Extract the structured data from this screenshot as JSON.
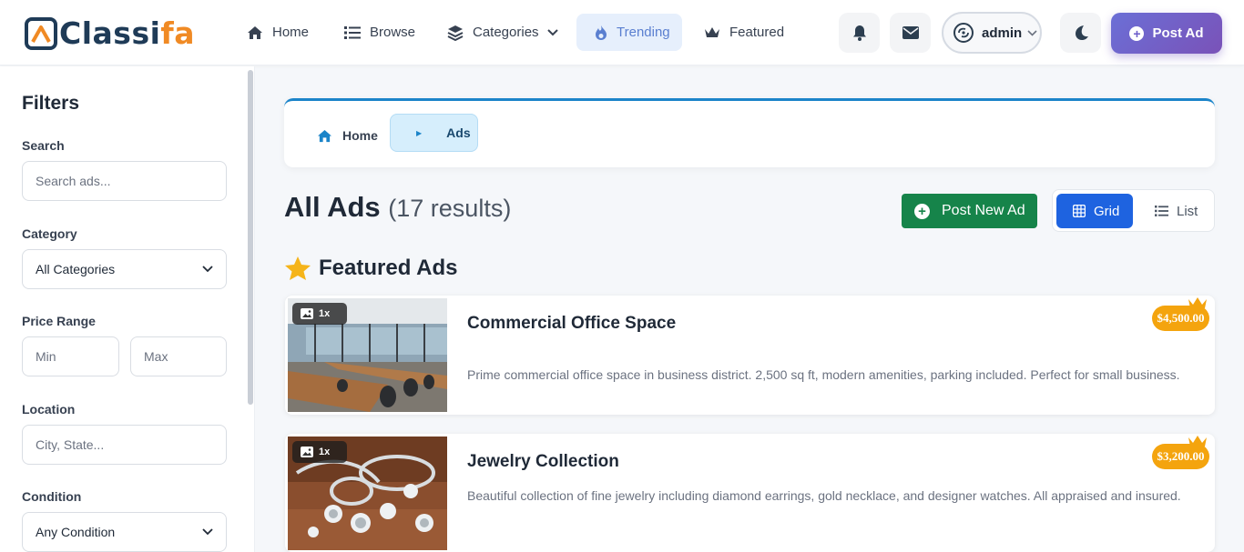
{
  "header": {
    "logo_left": "C",
    "logo_mid": "lassi",
    "logo_right": "fa",
    "nav": [
      {
        "label": "Home",
        "icon": "home-icon"
      },
      {
        "label": "Browse",
        "icon": "list-icon"
      },
      {
        "label": "Categories",
        "icon": "layers-icon"
      },
      {
        "label": "Trending",
        "icon": "fire-icon",
        "active": true
      },
      {
        "label": "Featured",
        "icon": "crown-icon"
      }
    ],
    "user": "admin",
    "post_ad": "Post Ad"
  },
  "sidebar": {
    "title": "Filters",
    "search_label": "Search",
    "search_placeholder": "Search ads...",
    "category_label": "Category",
    "category_value": "All Categories",
    "price_label": "Price Range",
    "price_min_placeholder": "Min",
    "price_max_placeholder": "Max",
    "location_label": "Location",
    "location_placeholder": "City, State...",
    "condition_label": "Condition",
    "condition_value": "Any Condition"
  },
  "breadcrumb": {
    "home": "Home",
    "current": "Ads"
  },
  "main": {
    "title": "All Ads",
    "count": "(17 results)",
    "post_new": "Post New Ad",
    "view_grid": "Grid",
    "view_list": "List",
    "featured_title": "Featured Ads"
  },
  "ads": [
    {
      "title": "Commercial Office Space",
      "description": "Prime commercial office space in business district. 2,500 sq ft, modern amenities, parking included. Perfect for small business.",
      "price": "$4,500.00",
      "image_count": "1x"
    },
    {
      "title": "Jewelry Collection",
      "description": "Beautiful collection of fine jewelry including diamond earrings, gold necklace, and designer watches. All appraised and insured.",
      "price": "$3,200.00",
      "image_count": "1x"
    }
  ],
  "colors": {
    "primary": "#1e63e0",
    "success": "#16844a",
    "accent": "#f4a40e",
    "brand_dark": "#1f3b57",
    "brand_orange": "#f08a24"
  }
}
